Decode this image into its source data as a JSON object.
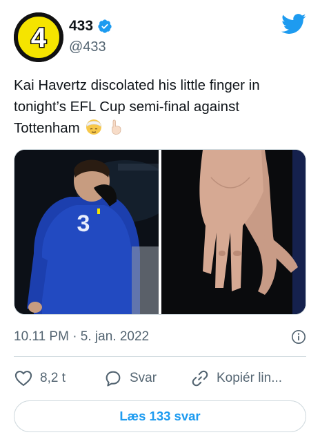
{
  "user": {
    "display_name": "433",
    "handle": "@433",
    "avatar_text": "4",
    "verified": true
  },
  "tweet": {
    "text": "Kai Havertz discolated his little finger in tonight’s EFL Cup semi-final against Tottenham",
    "emojis": [
      "face-with-head-bandage",
      "index-pointing-up-light-skin-tone"
    ]
  },
  "media": [
    {
      "description": "player",
      "shirt_number": "3"
    },
    {
      "description": "hand"
    }
  ],
  "timestamp": "10.11 PM · 5. jan. 2022",
  "actions": {
    "likes": "8,2 t",
    "reply_label": "Svar",
    "copy_label": "Kopiér lin..."
  },
  "read_replies_label": "Læs 133 svar",
  "colors": {
    "accent": "#1d9bf0",
    "text": "#0f1419",
    "muted": "#536471",
    "border": "#cfd9de",
    "avatar_yellow": "#f5e400"
  }
}
